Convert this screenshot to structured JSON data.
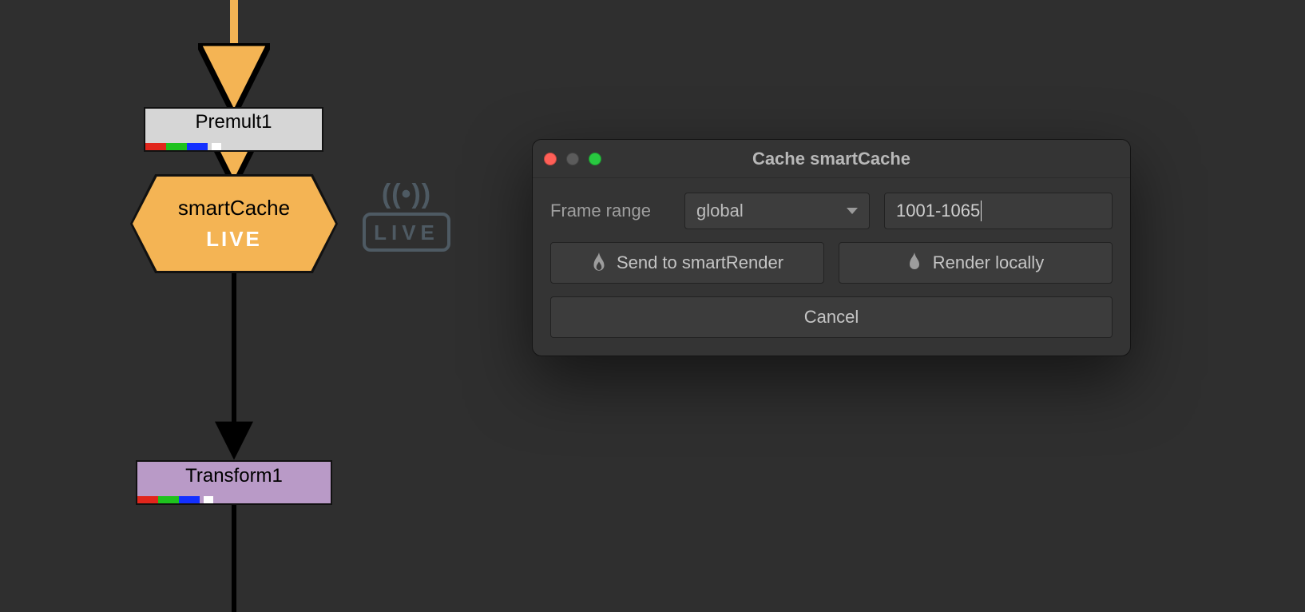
{
  "nodes": {
    "premult": {
      "label": "Premult1"
    },
    "smartcache": {
      "label": "smartCache",
      "status": "LIVE"
    },
    "transform": {
      "label": "Transform1"
    }
  },
  "live_badge": {
    "signal": "((•))",
    "text": "LIVE"
  },
  "dialog": {
    "title": "Cache smartCache",
    "frame_range_label": "Frame range",
    "range_mode": "global",
    "range_value": "1001-1065",
    "send_label": "Send to smartRender",
    "render_label": "Render locally",
    "cancel_label": "Cancel"
  },
  "colors": {
    "channel_r": "#e1261c",
    "channel_g": "#1ec21e",
    "channel_b": "#1330ff",
    "channel_a": "#ffffff"
  }
}
